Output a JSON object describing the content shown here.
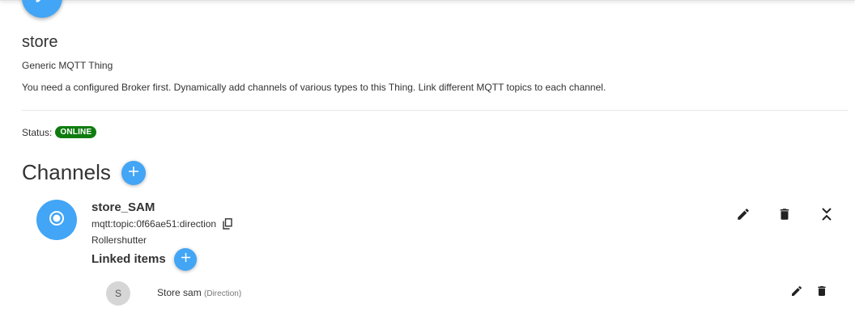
{
  "thing": {
    "title": "store",
    "type_label": "Generic MQTT Thing",
    "description": "You need a configured Broker first. Dynamically add channels of various types to this Thing. Link different MQTT topics to each channel.",
    "status_label": "Status:",
    "status_value": "ONLINE",
    "status_color": "#107c10"
  },
  "channels": {
    "heading": "Channels",
    "items": [
      {
        "name": "store_SAM",
        "uid": "mqtt:topic:0f66ae51:direction",
        "type": "Rollershutter",
        "linked_heading": "Linked items",
        "linked_items": [
          {
            "avatar_letter": "S",
            "label": "Store sam",
            "tag": "(Direction)"
          }
        ]
      }
    ]
  },
  "icons": {
    "thing": "pencil-icon",
    "add": "plus-icon",
    "channel": "radio-button-icon",
    "copy": "copy-icon",
    "edit": "pencil-icon",
    "delete": "trash-icon",
    "collapse": "collapse-icon"
  },
  "colors": {
    "accent": "#42a5f5",
    "online": "#107c10"
  }
}
